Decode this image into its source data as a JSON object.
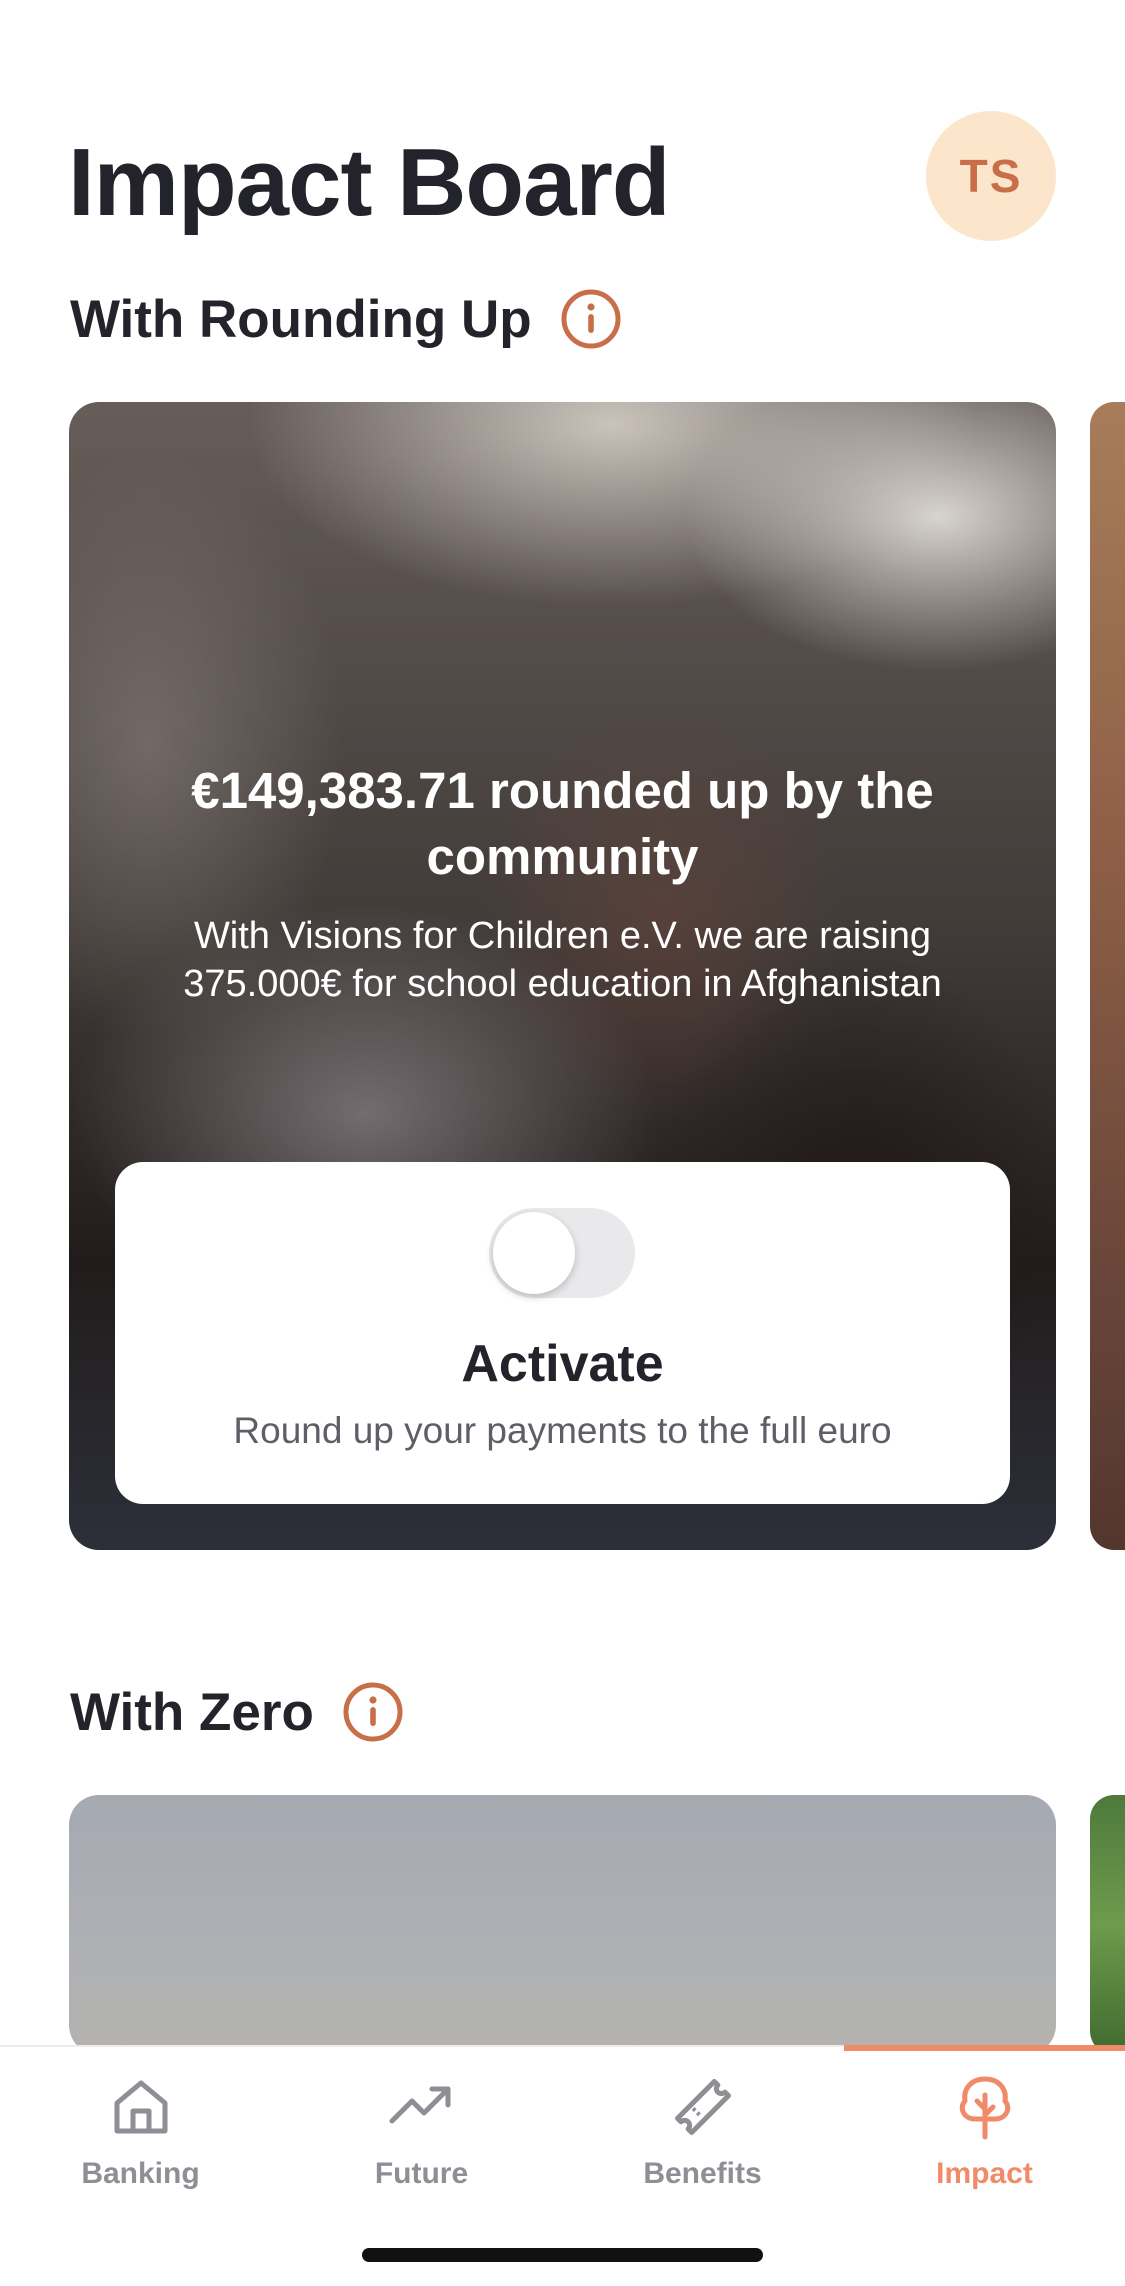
{
  "header": {
    "title": "Impact Board",
    "avatar_initials": "TS"
  },
  "sections": {
    "rounding_up": {
      "heading": "With Rounding Up",
      "info_icon": "info-circle-icon",
      "card": {
        "headline": "€149,383.71 rounded up by the community",
        "description": "With Visions for Children e.V. we are raising 375.000€ for school education in Afghanistan",
        "toggle_on": false,
        "activate_title": "Activate",
        "activate_subtitle": "Round up your payments to the full euro"
      }
    },
    "zero": {
      "heading": "With Zero",
      "info_icon": "info-circle-icon"
    }
  },
  "tab_bar": {
    "tabs": [
      {
        "label": "Banking",
        "icon": "home-icon",
        "active": false
      },
      {
        "label": "Future",
        "icon": "trend-up-icon",
        "active": false
      },
      {
        "label": "Benefits",
        "icon": "ticket-icon",
        "active": false
      },
      {
        "label": "Impact",
        "icon": "tree-icon",
        "active": true
      }
    ]
  },
  "colors": {
    "accent": "#f08a68",
    "info_icon": "#c86f49",
    "avatar_bg": "#fbe6cc",
    "text_primary": "#23232b",
    "tab_inactive": "#8e8e95"
  }
}
